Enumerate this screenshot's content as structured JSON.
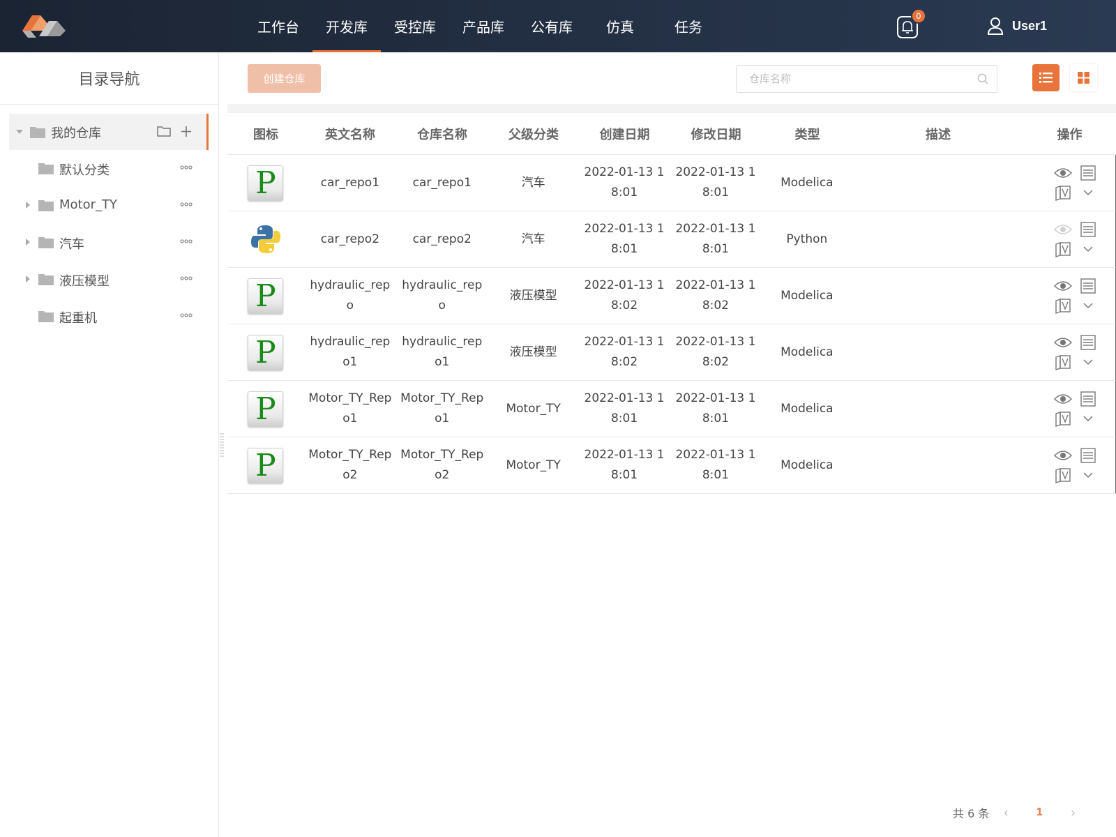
{
  "header": {
    "nav": [
      {
        "label": "工作台",
        "active": false
      },
      {
        "label": "开发库",
        "active": true
      },
      {
        "label": "受控库",
        "active": false
      },
      {
        "label": "产品库",
        "active": false
      },
      {
        "label": "公有库",
        "active": false
      },
      {
        "label": "仿真",
        "active": false
      },
      {
        "label": "任务",
        "active": false
      }
    ],
    "notification_count": "0",
    "user_name": "User1",
    "accent_color": "#e8743b"
  },
  "sidebar": {
    "title": "目录导航",
    "root": {
      "label": "我的仓库"
    },
    "items": [
      {
        "label": "默认分类",
        "expandable": false
      },
      {
        "label": "Motor_TY",
        "expandable": true
      },
      {
        "label": "汽车",
        "expandable": true
      },
      {
        "label": "液压模型",
        "expandable": true
      },
      {
        "label": "起重机",
        "expandable": false
      }
    ]
  },
  "toolbar": {
    "create_label": "创建仓库",
    "search_placeholder": "仓库名称"
  },
  "table": {
    "columns": [
      "图标",
      "英文名称",
      "仓库名称",
      "父级分类",
      "创建日期",
      "修改日期",
      "类型",
      "描述",
      "操作"
    ],
    "rows": [
      {
        "icon": "P",
        "en_name": "car_repo1",
        "name": "car_repo1",
        "parent": "汽车",
        "created": "2022-01-13 18:01",
        "modified": "2022-01-13 18:01",
        "type": "Modelica",
        "desc": ""
      },
      {
        "icon": "python",
        "en_name": "car_repo2",
        "name": "car_repo2",
        "parent": "汽车",
        "created": "2022-01-13 18:01",
        "modified": "2022-01-13 18:01",
        "type": "Python",
        "desc": ""
      },
      {
        "icon": "P",
        "en_name": "hydraulic_repo",
        "name": "hydraulic_repo",
        "parent": "液压模型",
        "created": "2022-01-13 18:02",
        "modified": "2022-01-13 18:02",
        "type": "Modelica",
        "desc": ""
      },
      {
        "icon": "P",
        "en_name": "hydraulic_repo1",
        "name": "hydraulic_repo1",
        "parent": "液压模型",
        "created": "2022-01-13 18:02",
        "modified": "2022-01-13 18:02",
        "type": "Modelica",
        "desc": ""
      },
      {
        "icon": "P",
        "en_name": "Motor_TY_Repo1",
        "name": "Motor_TY_Repo1",
        "parent": "Motor_TY",
        "created": "2022-01-13 18:01",
        "modified": "2022-01-13 18:01",
        "type": "Modelica",
        "desc": ""
      },
      {
        "icon": "P",
        "en_name": "Motor_TY_Repo2",
        "name": "Motor_TY_Repo2",
        "parent": "Motor_TY",
        "created": "2022-01-13 18:01",
        "modified": "2022-01-13 18:01",
        "type": "Modelica",
        "desc": ""
      }
    ]
  },
  "pagination": {
    "total_label": "共 6 条",
    "current_page": "1",
    "prev_icon": "chevron-left-icon",
    "next_icon": "chevron-right-icon"
  }
}
